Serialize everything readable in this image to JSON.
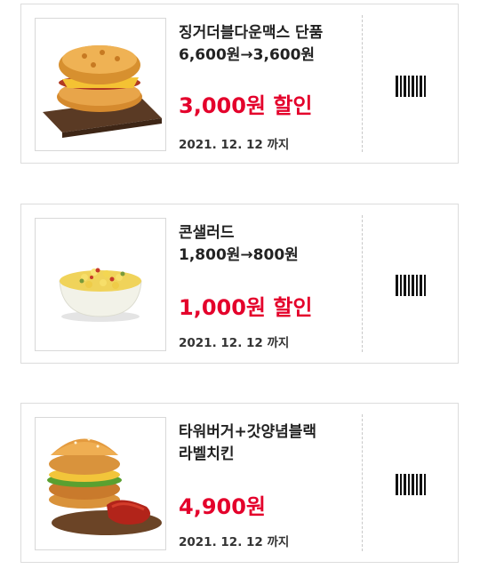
{
  "coupons": [
    {
      "name_lines": [
        "징거더블다운맥스 단품",
        "6,600원→3,600원"
      ],
      "discount": "3,000원 할인",
      "date": "2021. 12. 12 까지",
      "image": "zinger-double-down-max-burger",
      "barcode": "barcode-icon"
    },
    {
      "name_lines": [
        "콘샐러드",
        "1,800원→800원"
      ],
      "discount": "1,000원 할인",
      "date": "2021. 12. 12 까지",
      "image": "corn-salad-bowl",
      "barcode": "barcode-icon"
    },
    {
      "name_lines": [
        "타워버거+갓양념블랙",
        "라벨치킨"
      ],
      "discount": "4,900원",
      "date": "2021. 12. 12 까지",
      "image": "tower-burger-and-chicken",
      "barcode": "barcode-icon"
    }
  ],
  "colors": {
    "accent": "#e4002b",
    "border": "#dcdcdc",
    "text": "#222222"
  }
}
